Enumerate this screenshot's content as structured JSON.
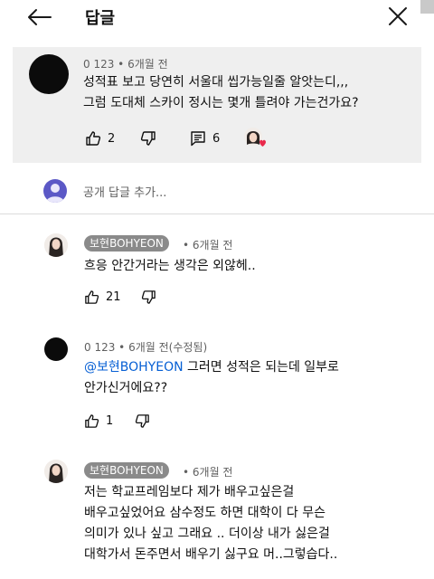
{
  "header": {
    "title": "답글"
  },
  "parent_comment": {
    "author": "0 123",
    "time": "6개월 전",
    "lines": [
      "성적표 보고 당연히 서울대 씹가능일줄 알앗는디,,,",
      "그럼 도대체 스카이 정시는 몇개 틀려야 가는건가요?"
    ],
    "likes": "2",
    "reply_count": "6"
  },
  "add_reply": {
    "placeholder": "공개 답글 추가..."
  },
  "replies": [
    {
      "author": "보현BOHYEON",
      "time": "6개월 전",
      "lines": [
        "흐응 안간거라는 생각은 외않헤.."
      ],
      "likes": "21"
    },
    {
      "author": "0 123",
      "time": "6개월 전(수정됨)",
      "mention": "@보현BOHYEON",
      "line1_rest": " 그러면 성적은 되는데 일부로",
      "line2": "안가신거에요??",
      "likes": "1"
    },
    {
      "author": "보현BOHYEON",
      "time": "6개월 전",
      "lines": [
        "저는 학교프레임보다 제가 배우고싶은걸",
        "배우고싶었어요 삼수정도 하면 대학이 다 무슨",
        "의미가 있나 싶고 그래요 .. 더이상 내가 싫은걸",
        "대학가서 돈주면서 배우기 싫구요 머..그렇습다.."
      ]
    }
  ],
  "colors": {
    "parent_bg": "#efefef",
    "mention": "#065fd4",
    "author_chip": "#8a8a8a",
    "add_avatar": "#5b58c6",
    "heart": "#e8294b"
  },
  "icons": [
    "back-arrow-icon",
    "close-icon",
    "thumb-up-icon",
    "thumb-down-icon",
    "reply-icon",
    "creator-heart-icon",
    "user-avatar-icon"
  ]
}
